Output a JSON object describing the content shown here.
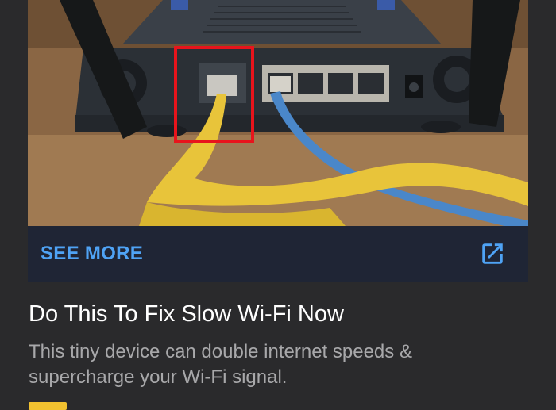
{
  "ad": {
    "image_alt": "router-rear-ports-photo",
    "cta_label": "SEE MORE",
    "cta_icon": "open-in-new-icon",
    "headline": "Do This To Fix Slow Wi-Fi Now",
    "description": "This tiny device can double internet speeds & supercharge your Wi-Fi signal."
  },
  "colors": {
    "background": "#2a2a2c",
    "cta_bar": "#1f2535",
    "cta_accent": "#4fa3f5",
    "highlight_box": "#e8141c",
    "badge": "#f2c230"
  }
}
